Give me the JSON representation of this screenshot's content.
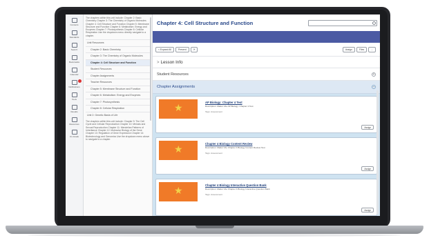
{
  "page": {
    "title": "Chapter 4: Cell Structure and Function"
  },
  "rail": [
    {
      "label": "Contents",
      "icon": "contents-icon"
    },
    {
      "label": "Standards",
      "icon": "standards-icon"
    },
    {
      "label": "Search",
      "icon": "search-icon"
    },
    {
      "label": "Bookmarks",
      "icon": "bookmark-icon"
    },
    {
      "label": "Calendar",
      "icon": "calendar-icon"
    },
    {
      "label": "Notifications",
      "icon": "bell-icon",
      "badge": true
    },
    {
      "label": "Tools",
      "icon": "tools-icon"
    },
    {
      "label": "Results",
      "icon": "results-icon"
    },
    {
      "label": "Resources",
      "icon": "resources-icon"
    },
    {
      "label": "Un-Grade",
      "icon": "pen-icon"
    }
  ],
  "outline": {
    "intro": "The chapters within this unit include: Chapter 2: Basic Chemistry Chapter 3: The Chemistry of Organic Molecules Chapter 4: Cell Structure and Function Chapter 5: Membrane Structure and Function Chapter 6: Metabolism: Energy and Enzymes Chapter 7: Photosynthesis Chapter 8: Cellular Respiration Use the dropdown menu directly navigate to a chapter.",
    "items": [
      {
        "label": "Unit Resources",
        "indent": false,
        "active": false
      },
      {
        "label": "Chapter 2: Basic Chemistry",
        "indent": true,
        "active": false
      },
      {
        "label": "Chapter 3: The Chemistry of Organic Molecules",
        "indent": true,
        "active": false
      },
      {
        "label": "Chapter 4: Cell Structure and Function",
        "indent": true,
        "active": true
      },
      {
        "label": "Student Resources",
        "indent": true,
        "active": false
      },
      {
        "label": "Chapter Assignments",
        "indent": true,
        "active": false
      },
      {
        "label": "Teacher Resources",
        "indent": true,
        "active": false
      },
      {
        "label": "Chapter 5: Membrane Structure and Function",
        "indent": true,
        "active": false
      },
      {
        "label": "Chapter 6: Metabolism: Energy and Enzymes",
        "indent": true,
        "active": false
      },
      {
        "label": "Chapter 7: Photosynthesis",
        "indent": true,
        "active": false
      },
      {
        "label": "Chapter 8: Cellular Respiration",
        "indent": true,
        "active": false
      },
      {
        "label": "Unit 2: Genetic Basis of Life",
        "indent": false,
        "active": false
      }
    ],
    "unit2_intro": "The chapters within this unit include: Chapter 9: The Cell Cycle and Cellular Reproduction Chapter 10: Meiosis and Sexual Reproduction Chapter 11: Mendelian Patterns of Inheritance Chapter 12: Molecular Biology of the Gene Chapter 13: Regulation of Gene Expression Chapter 14: Biotechnology and Genomics Use the dropdown menu above to navigate to a chapter."
  },
  "toolbar": {
    "left": [
      "< Expand All",
      "Present",
      "⟳"
    ],
    "right": [
      "Assign",
      "Files",
      "..."
    ]
  },
  "sections": {
    "lesson_info": "Lesson Info",
    "student_resources": "Student Resources",
    "chapter_assignments": "Chapter Assignments"
  },
  "assignments": [
    {
      "title": "AP Biology: Chapter 4 Test",
      "desc": "Description: Mader 13e AP Biology: Chapter 4 Test",
      "tags": "Tags: Assessment",
      "button": "Assign"
    },
    {
      "title": "Chapter 4 Biology Content Review",
      "desc": "Description: Mader 13e Chapter 4 Biology Content Review Test",
      "tags": "Tags: Assessment",
      "button": "Assign"
    },
    {
      "title": "Chapter 4 Biology Interactive Question Bank",
      "desc": "Description: Mader 13e Chapter 4 Biology Interactive Question Bank",
      "tags": "Tags: Assessment",
      "button": "Assign"
    }
  ],
  "colors": {
    "banner": "#4b5aa3",
    "title": "#2b4a8b",
    "thumb": "#f07a28",
    "assign_bg": "#cfe3f1"
  }
}
